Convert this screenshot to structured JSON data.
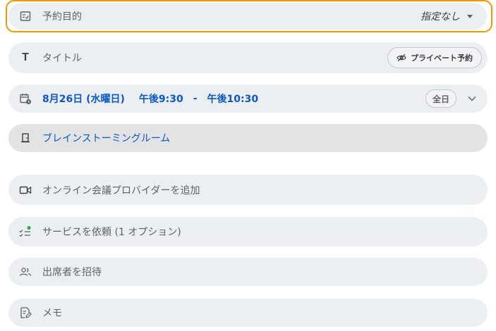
{
  "purpose": {
    "label": "予約目的",
    "value": "指定なし"
  },
  "title": {
    "placeholder": "タイトル",
    "icon_glyph": "T",
    "private_label": "プライベート予約"
  },
  "datetime": {
    "date": "8月26日 (水曜日)",
    "start": "午後9:30",
    "separator": "-",
    "end": "午後10:30",
    "allday_label": "全日"
  },
  "room": {
    "name": "ブレインストーミングルーム"
  },
  "online": {
    "label": "オンライン会議プロバイダーを追加"
  },
  "service": {
    "label": "サービスを依頼 (1 オプション)"
  },
  "guests": {
    "label": "出席者を招待"
  },
  "memo": {
    "label": "メモ"
  },
  "colors": {
    "focus_outline": "#f29900",
    "link_blue": "#0b57d0",
    "status_green": "#34a853"
  }
}
